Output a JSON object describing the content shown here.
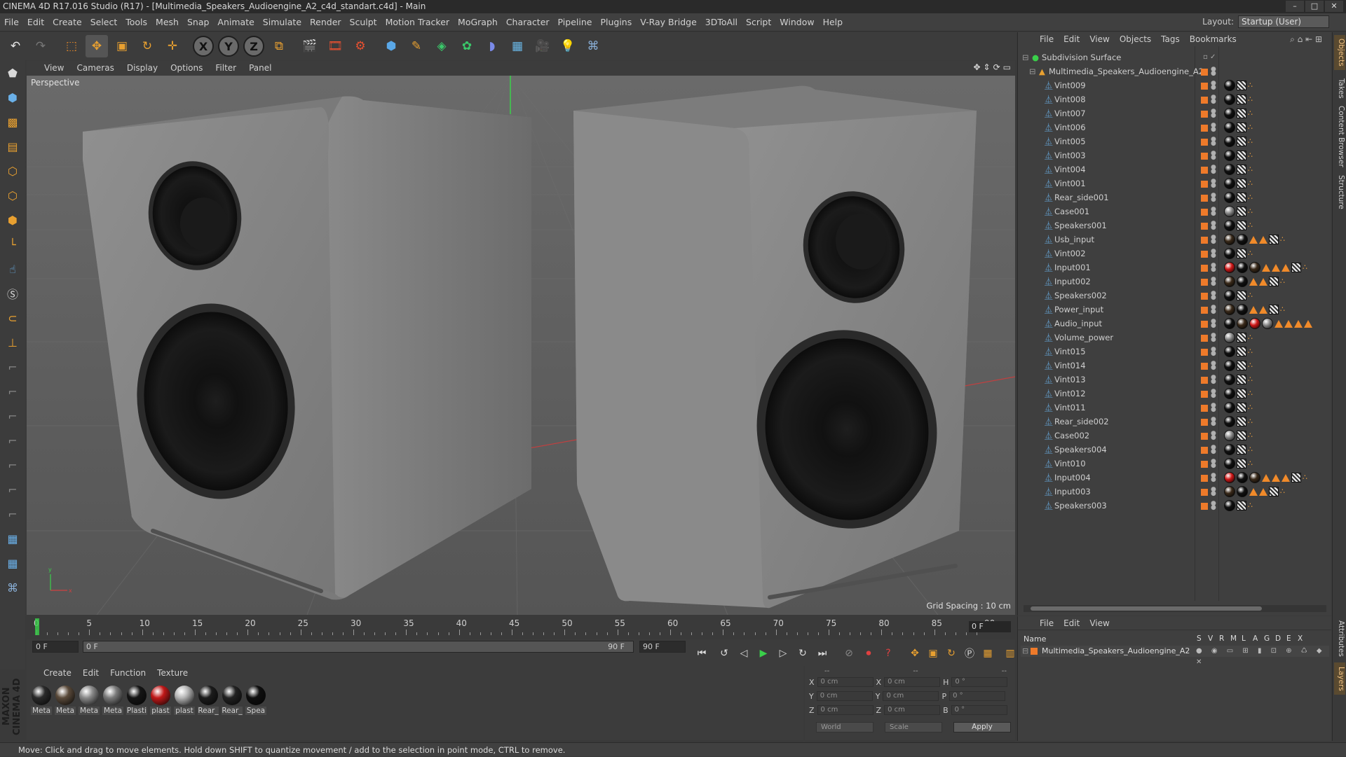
{
  "window": {
    "title": "CINEMA 4D R17.016 Studio (R17) - [Multimedia_Speakers_Audioengine_A2_c4d_standart.c4d] - Main",
    "buttons": [
      "–",
      "□",
      "✕"
    ]
  },
  "menubar": {
    "items": [
      "File",
      "Edit",
      "Create",
      "Select",
      "Tools",
      "Mesh",
      "Snap",
      "Animate",
      "Simulate",
      "Render",
      "Sculpt",
      "Motion Tracker",
      "MoGraph",
      "Character",
      "Pipeline",
      "Plugins",
      "V-Ray Bridge",
      "3DToAll",
      "Script",
      "Window",
      "Help"
    ],
    "layout_label": "Layout:",
    "layout_value": "Startup (User)"
  },
  "viewport": {
    "menu": [
      "View",
      "Cameras",
      "Display",
      "Options",
      "Filter",
      "Panel"
    ],
    "label": "Perspective",
    "grid_spacing": "Grid Spacing : 10 cm"
  },
  "timeline": {
    "ticks": [
      "0",
      "5",
      "10",
      "15",
      "20",
      "25",
      "30",
      "35",
      "40",
      "45",
      "50",
      "55",
      "60",
      "65",
      "70",
      "75",
      "80",
      "85",
      "90"
    ],
    "current_frame": "0 F",
    "start_field": "0 F",
    "range_start": "0 F",
    "range_end": "90 F",
    "end_field": "90 F"
  },
  "materials": {
    "menu": [
      "Create",
      "Edit",
      "Function",
      "Texture"
    ],
    "items": [
      {
        "label": "Meta",
        "color": "#2a2a2a"
      },
      {
        "label": "Meta",
        "color": "#5a4a3a"
      },
      {
        "label": "Meta",
        "color": "#8a8a8a"
      },
      {
        "label": "Meta",
        "color": "#7a7a7a"
      },
      {
        "label": "Plasti",
        "color": "#151515"
      },
      {
        "label": "plast",
        "color": "#c01818"
      },
      {
        "label": "plast",
        "color": "#b5b5b5"
      },
      {
        "label": "Rear_",
        "color": "#1c1c1c"
      },
      {
        "label": "Rear_",
        "color": "#222222"
      },
      {
        "label": "Spea",
        "color": "#0e0e0e"
      }
    ]
  },
  "coords": {
    "header": [
      "--",
      "--",
      "--"
    ],
    "rows": [
      {
        "a": "X",
        "av": "0 cm",
        "b": "X",
        "bv": "0 cm",
        "c": "H",
        "cv": "0 °"
      },
      {
        "a": "Y",
        "av": "0 cm",
        "b": "Y",
        "bv": "0 cm",
        "c": "P",
        "cv": "0 °"
      },
      {
        "a": "Z",
        "av": "0 cm",
        "b": "Z",
        "bv": "0 cm",
        "c": "B",
        "cv": "0 °"
      }
    ],
    "mode1": "World",
    "mode2": "Scale",
    "apply": "Apply"
  },
  "objects": {
    "menu": [
      "File",
      "Edit",
      "View",
      "Objects",
      "Tags",
      "Bookmarks"
    ],
    "root": "Subdivision Surface",
    "group": "Multimedia_Speakers_Audioengine_A2",
    "items": [
      {
        "name": "Vint009",
        "tags": "b"
      },
      {
        "name": "Vint008",
        "tags": "b"
      },
      {
        "name": "Vint007",
        "tags": "b"
      },
      {
        "name": "Vint006",
        "tags": "b"
      },
      {
        "name": "Vint005",
        "tags": "b"
      },
      {
        "name": "Vint003",
        "tags": "b"
      },
      {
        "name": "Vint004",
        "tags": "b"
      },
      {
        "name": "Vint001",
        "tags": "b"
      },
      {
        "name": "Rear_side001",
        "tags": "b"
      },
      {
        "name": "Case001",
        "tags": "g"
      },
      {
        "name": "Speakers001",
        "tags": "b"
      },
      {
        "name": "Usb_input",
        "tags": "m"
      },
      {
        "name": "Vint002",
        "tags": "b"
      },
      {
        "name": "Input001",
        "tags": "l"
      },
      {
        "name": "Input002",
        "tags": "m"
      },
      {
        "name": "Speakers002",
        "tags": "b"
      },
      {
        "name": "Power_input",
        "tags": "m"
      },
      {
        "name": "Audio_input",
        "tags": "a"
      },
      {
        "name": "Volume_power",
        "tags": "g"
      },
      {
        "name": "Vint015",
        "tags": "b"
      },
      {
        "name": "Vint014",
        "tags": "b"
      },
      {
        "name": "Vint013",
        "tags": "b"
      },
      {
        "name": "Vint012",
        "tags": "b"
      },
      {
        "name": "Vint011",
        "tags": "b"
      },
      {
        "name": "Rear_side002",
        "tags": "b"
      },
      {
        "name": "Case002",
        "tags": "g"
      },
      {
        "name": "Speakers004",
        "tags": "b"
      },
      {
        "name": "Vint010",
        "tags": "b"
      },
      {
        "name": "Input004",
        "tags": "l"
      },
      {
        "name": "Input003",
        "tags": "m"
      },
      {
        "name": "Speakers003",
        "tags": "b"
      }
    ]
  },
  "layers": {
    "menu": [
      "File",
      "Edit",
      "View"
    ],
    "name_header": "Name",
    "cols": [
      "S",
      "V",
      "R",
      "M",
      "L",
      "A",
      "G",
      "D",
      "E",
      "X"
    ],
    "row": "Multimedia_Speakers_Audioengine_A2"
  },
  "right_tabs": [
    "Objects",
    "Takes",
    "Content Browser",
    "Structure",
    "Attributes",
    "Layers"
  ],
  "logo": "MAXON CINEMA 4D",
  "status": "Move: Click and drag to move elements. Hold down SHIFT to quantize movement / add to the selection in point mode, CTRL to remove."
}
